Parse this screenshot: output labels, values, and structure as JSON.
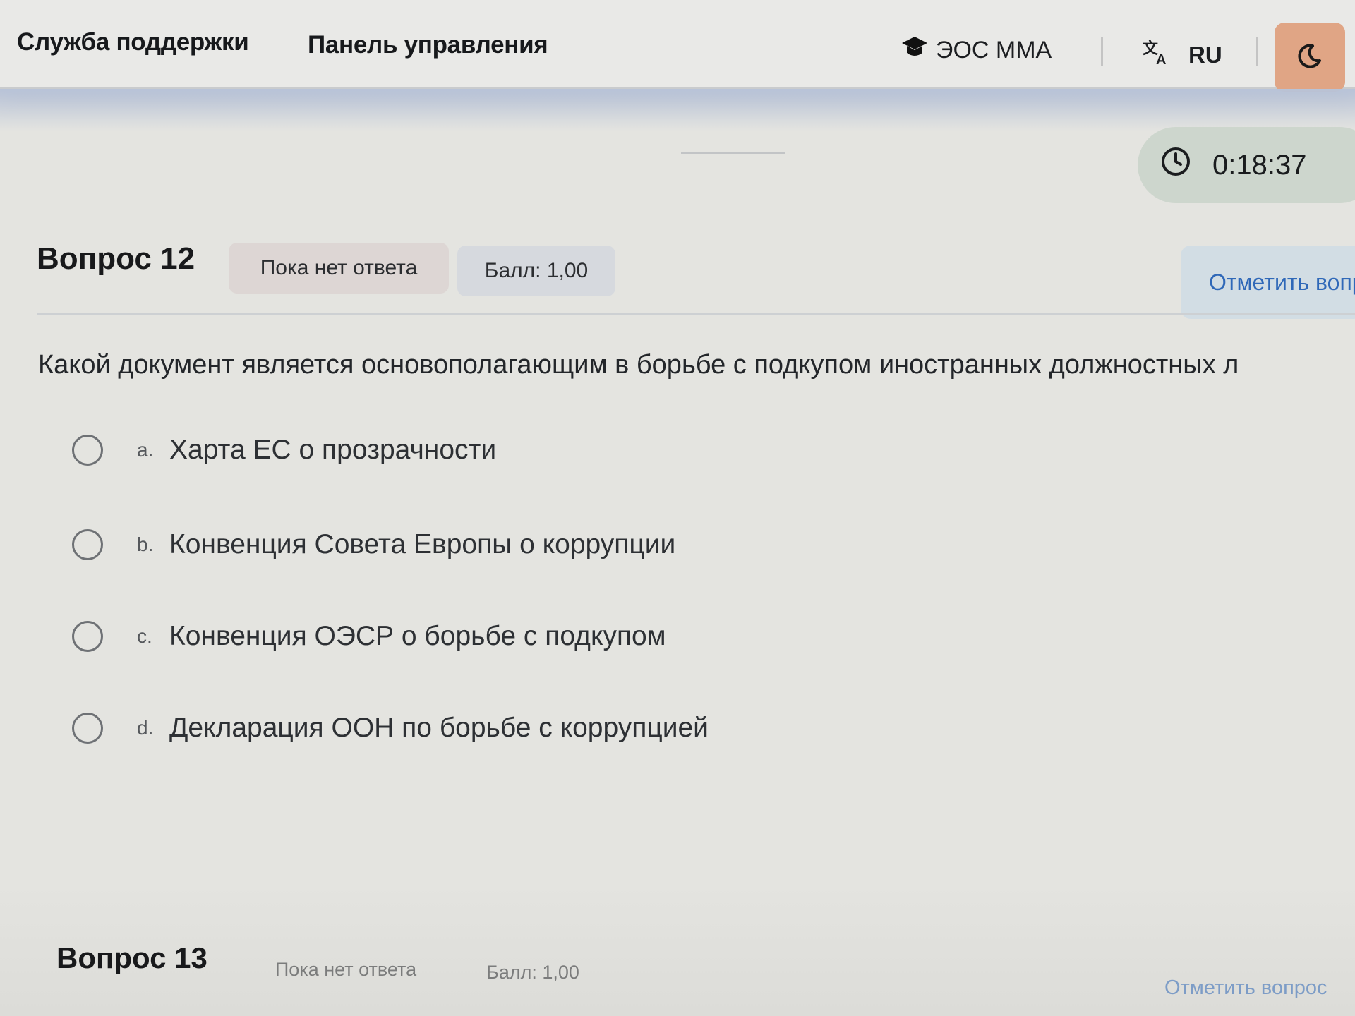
{
  "nav": {
    "support": "Служба поддержки",
    "dashboard": "Панель управления",
    "brand": "ЭОС ММА",
    "lang": "RU"
  },
  "timer": {
    "value": "0:18:37"
  },
  "question12": {
    "title": "Вопрос 12",
    "status": "Пока нет ответа",
    "score": "Балл: 1,00",
    "flag_label": "Отметить вопрос",
    "text": "Какой документ является основополагающим в борьбе с подкупом иностранных должностных л",
    "options": [
      {
        "letter": "a.",
        "text": "Харта ЕС о прозрачности"
      },
      {
        "letter": "b.",
        "text": "Конвенция Совета Европы о коррупции"
      },
      {
        "letter": "c.",
        "text": "Конвенция ОЭСР о борьбе с подкупом"
      },
      {
        "letter": "d.",
        "text": "Декларация ООН по борьбе с коррупцией"
      }
    ]
  },
  "question13": {
    "title": "Вопрос 13",
    "status": "Пока нет ответа",
    "score": "Балл: 1,00",
    "flag_label": "Отметить вопрос"
  },
  "colors": {
    "accent_blue": "#2f68b8",
    "theme_button": "#e0a585",
    "timer_bg": "#cdd6cd"
  },
  "icons": [
    "graduation-cap-icon",
    "translate-icon",
    "moon-icon",
    "clock-icon",
    "radio-icon"
  ]
}
